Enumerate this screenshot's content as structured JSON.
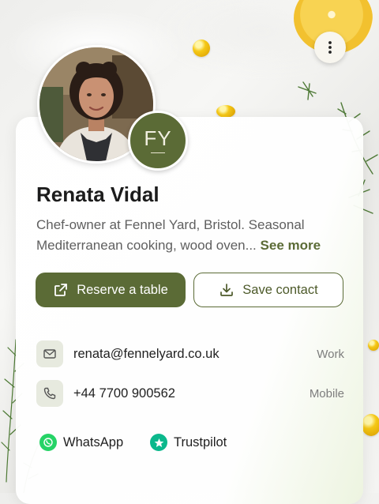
{
  "profile": {
    "name": "Renata Vidal",
    "monogram": "FY",
    "bio": "Chef-owner at Fennel Yard, Bristol. Seasonal Mediterranean cooking, wood oven...",
    "see_more": "See more"
  },
  "actions": {
    "reserve_label": "Reserve a table",
    "save_label": "Save contact"
  },
  "contacts": [
    {
      "icon": "envelope-icon",
      "value": "renata@fennelyard.co.uk",
      "tag": "Work"
    },
    {
      "icon": "phone-icon",
      "value": "+44 7700 900562",
      "tag": "Mobile"
    }
  ],
  "socials": [
    {
      "icon": "whatsapp-icon",
      "label": "WhatsApp",
      "color": "#25d366"
    },
    {
      "icon": "trustpilot-star-icon",
      "label": "Trustpilot",
      "color": "#0bb88c"
    }
  ],
  "colors": {
    "accent": "#5b6b36",
    "icon_tile": "#e7eadf"
  }
}
